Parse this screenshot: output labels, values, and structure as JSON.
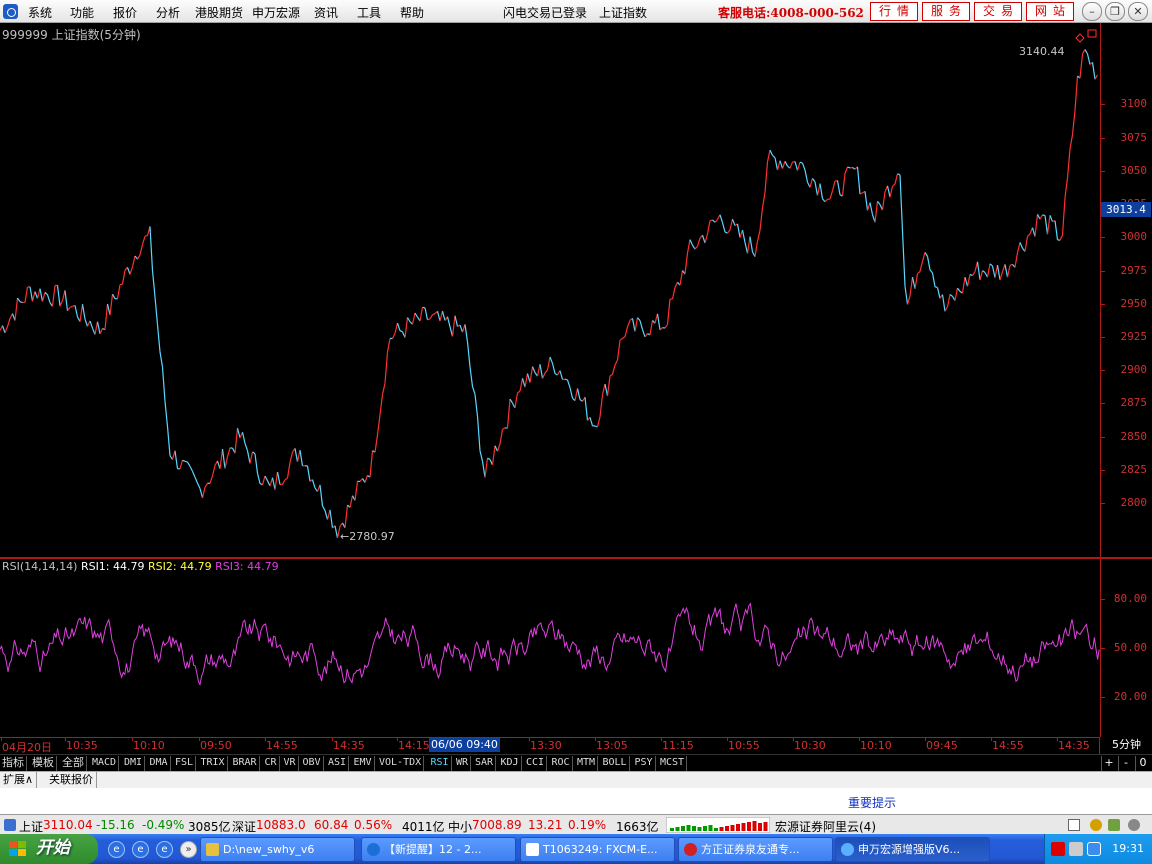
{
  "menubar": {
    "items": [
      "系统",
      "功能",
      "报价",
      "分析",
      "港股期货",
      "申万宏源",
      "资讯",
      "工具",
      "帮助"
    ],
    "login_status": "闪电交易已登录",
    "index_name": "上证指数",
    "hotline": "客服电话:4008-000-562",
    "service_buttons": [
      "行情",
      "服务",
      "交易",
      "网站"
    ]
  },
  "chart": {
    "title": "999999 上证指数(5分钟)",
    "high_label": "3140.44",
    "low_label": "2780.97",
    "current_price": "3013.4",
    "price_ticks": [
      "3100",
      "3075",
      "3050",
      "3025",
      "3000",
      "2975",
      "2950",
      "2925",
      "2900",
      "2875",
      "2850",
      "2825",
      "2800"
    ],
    "rsi_ticks": [
      "80.00",
      "50.00",
      "20.00"
    ],
    "time_ticks": [
      "04月20日",
      "10:35",
      "10:10",
      "09:50",
      "14:55",
      "14:35",
      "14:15",
      "06/06 09:40",
      "13:30",
      "13:05",
      "11:15",
      "10:55",
      "10:30",
      "10:10",
      "09:45",
      "14:55",
      "14:35"
    ],
    "period": "5分钟",
    "colors": {
      "up": "#ff3030",
      "down": "#58d8ff",
      "rsi": "#e040e0",
      "axis": "#b01818"
    }
  },
  "chart_data": [
    {
      "type": "line",
      "ylim": [
        2770,
        3150
      ],
      "x": [
        0,
        30,
        60,
        100,
        140,
        150,
        158,
        170,
        200,
        240,
        270,
        300,
        338,
        372,
        390,
        425,
        465,
        485,
        520,
        555,
        575,
        595,
        625,
        665,
        690,
        720,
        755,
        770,
        800,
        830,
        855,
        875,
        900,
        906,
        925,
        945,
        975,
        1005,
        1040,
        1062,
        1070,
        1078,
        1085,
        1092,
        1100
      ],
      "values": [
        2930,
        2960,
        2955,
        2930,
        2995,
        3000,
        2930,
        2840,
        2810,
        2850,
        2810,
        2840,
        2780,
        2830,
        2925,
        2940,
        2930,
        2820,
        2890,
        2905,
        2885,
        2860,
        2930,
        2935,
        2990,
        3015,
        2990,
        3060,
        3055,
        3030,
        3050,
        3015,
        3055,
        2945,
        2995,
        2945,
        2975,
        2975,
        3015,
        3000,
        3060,
        3120,
        3140,
        3130,
        3120
      ]
    },
    {
      "type": "line",
      "ylim": [
        0,
        100
      ],
      "series": [
        {
          "name": "RSI1",
          "values": [
            44.79
          ]
        },
        {
          "name": "RSI2",
          "values": [
            44.79
          ]
        },
        {
          "name": "RSI3",
          "values": [
            44.79
          ]
        }
      ]
    }
  ],
  "rsi_legend": {
    "params": "RSI(14,14,14)",
    "rsi1": "RSI1: 44.79",
    "rsi2": "RSI2: 44.79",
    "rsi3": "RSI3: 44.79"
  },
  "indicator_tabs": [
    "指标",
    "模板",
    "全部",
    "MACD",
    "DMI",
    "DMA",
    "FSL",
    "TRIX",
    "BRAR",
    "CR",
    "VR",
    "OBV",
    "ASI",
    "EMV",
    "VOL-TDX",
    "RSI",
    "WR",
    "SAR",
    "KDJ",
    "CCI",
    "ROC",
    "MTM",
    "BOLL",
    "PSY",
    "MCST"
  ],
  "active_indicator": "RSI",
  "tab_controls": [
    "+",
    "-",
    "0"
  ],
  "ext_tabs": [
    "扩展∧",
    "关联报价"
  ],
  "notice": "重要提示",
  "statusbar": {
    "sh_label": "上证",
    "sh_value": "3110.04",
    "sh_change": "-15.16",
    "sh_pct": "-0.49%",
    "sh_amount": "3085亿",
    "sz_label": "深证",
    "sz_value": "10883.0",
    "sz_change": "60.84",
    "sz_pct": "0.56%",
    "sz_amount": "4011亿",
    "zx_label": "中小",
    "zx_value": "7008.89",
    "zx_change": "13.21",
    "zx_pct": "0.19%",
    "zx_amount": "1663亿",
    "server": "宏源证券阿里云(4)"
  },
  "taskbar": {
    "start_label": "开始",
    "tasks": [
      "D:\\new_swhy_v6",
      "【新提醒】12 - 2...",
      "T1063249: FXCM-E...",
      "方正证券泉友通专...",
      "申万宏源增强版V6..."
    ],
    "clock": "19:31"
  }
}
